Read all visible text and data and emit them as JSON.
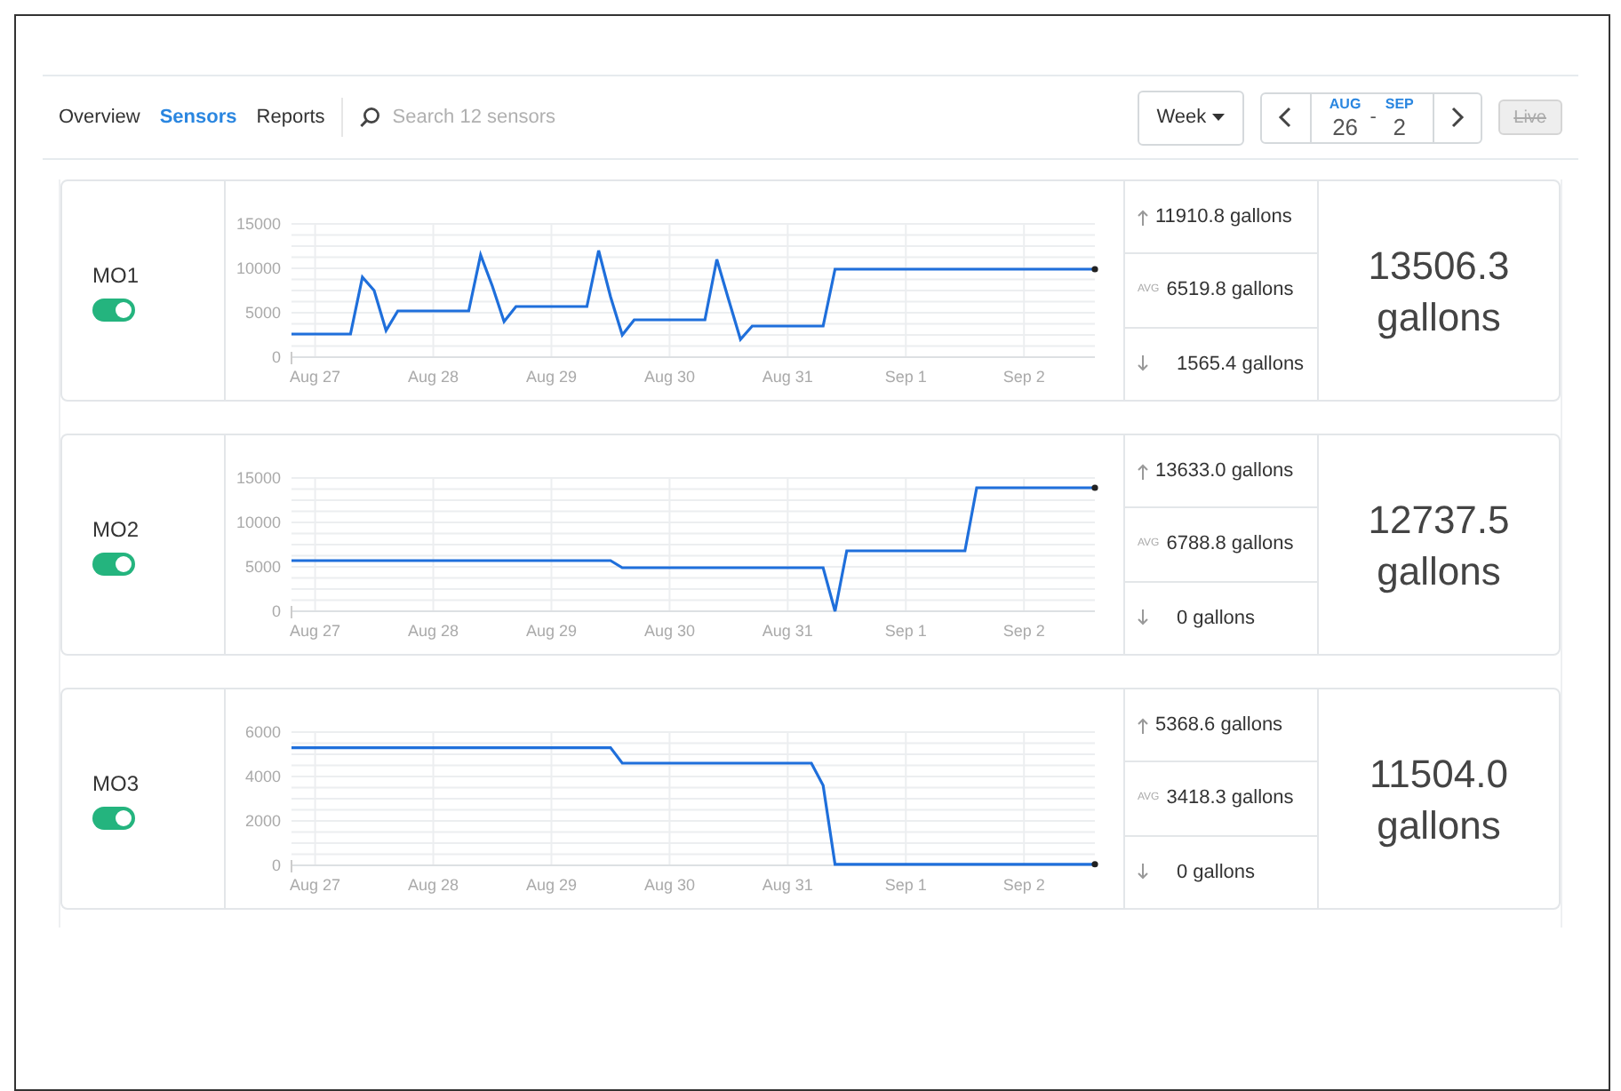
{
  "nav": {
    "tabs": [
      {
        "label": "Overview",
        "selected": false
      },
      {
        "label": "Sensors",
        "selected": true
      },
      {
        "label": "Reports",
        "selected": false
      }
    ],
    "search": {
      "placeholder": "Search 12 sensors"
    },
    "period": {
      "label": "Week"
    },
    "range": {
      "start_month": "AUG",
      "start_day": "26",
      "separator": "-",
      "end_month": "SEP",
      "end_day": "2"
    },
    "live": {
      "label": "Live",
      "disabled": true
    }
  },
  "sensors": [
    {
      "name": "MO1",
      "on": true,
      "max": "11910.8 gallons",
      "avg_label": "AVG",
      "avg": "6519.8 gallons",
      "min": "1565.4 gallons",
      "total": "13506.3",
      "unit": "gallons",
      "chart_data": {
        "type": "line",
        "grid": true,
        "ylim": [
          0,
          15000
        ],
        "yticks": [
          0,
          5000,
          10000,
          15000
        ],
        "categories": [
          null,
          null,
          "Aug 27",
          null,
          null,
          null,
          null,
          null,
          null,
          null,
          null,
          null,
          "Aug 28",
          null,
          null,
          null,
          null,
          null,
          null,
          null,
          null,
          null,
          "Aug 29",
          null,
          null,
          null,
          null,
          null,
          null,
          null,
          null,
          null,
          "Aug 30",
          null,
          null,
          null,
          null,
          null,
          null,
          null,
          null,
          null,
          "Aug 31",
          null,
          null,
          null,
          null,
          null,
          null,
          null,
          null,
          null,
          "Sep 1",
          null,
          null,
          null,
          null,
          null,
          null,
          null,
          null,
          null,
          "Sep 2",
          null,
          null,
          null,
          null,
          null,
          null
        ],
        "series": [
          {
            "color": "#1f6fdb",
            "values": [
              2600,
              2600,
              2600,
              2600,
              2600,
              2600,
              9000,
              7500,
              3000,
              5200,
              5200,
              5200,
              5200,
              5200,
              5200,
              5200,
              11500,
              8000,
              4000,
              5700,
              5700,
              5700,
              5700,
              5700,
              5700,
              5700,
              12000,
              6800,
              2500,
              4200,
              4200,
              4200,
              4200,
              4200,
              4200,
              4200,
              11000,
              6500,
              2000,
              3500,
              3500,
              3500,
              3500,
              3500,
              3500,
              3500,
              9900,
              9900,
              9900,
              9900,
              9900,
              9900,
              9900,
              9900,
              9900,
              9900,
              9900,
              9900,
              9900,
              9900,
              9900,
              9900,
              9900,
              9900,
              9900,
              9900,
              9900,
              9900,
              9900
            ]
          }
        ]
      }
    },
    {
      "name": "MO2",
      "on": true,
      "max": "13633.0 gallons",
      "avg_label": "AVG",
      "avg": "6788.8 gallons",
      "min": "0 gallons",
      "total": "12737.5",
      "unit": "gallons",
      "chart_data": {
        "type": "line",
        "grid": true,
        "ylim": [
          0,
          15000
        ],
        "yticks": [
          0,
          5000,
          10000,
          15000
        ],
        "categories": [
          null,
          null,
          "Aug 27",
          null,
          null,
          null,
          null,
          null,
          null,
          null,
          null,
          null,
          "Aug 28",
          null,
          null,
          null,
          null,
          null,
          null,
          null,
          null,
          null,
          "Aug 29",
          null,
          null,
          null,
          null,
          null,
          null,
          null,
          null,
          null,
          "Aug 30",
          null,
          null,
          null,
          null,
          null,
          null,
          null,
          null,
          null,
          "Aug 31",
          null,
          null,
          null,
          null,
          null,
          null,
          null,
          null,
          null,
          "Sep 1",
          null,
          null,
          null,
          null,
          null,
          null,
          null,
          null,
          null,
          "Sep 2",
          null,
          null,
          null,
          null,
          null,
          null
        ],
        "series": [
          {
            "color": "#1f6fdb",
            "values": [
              5700,
              5700,
              5700,
              5700,
              5700,
              5700,
              5700,
              5700,
              5700,
              5700,
              5700,
              5700,
              5700,
              5700,
              5700,
              5700,
              5700,
              5700,
              5700,
              5700,
              5700,
              5700,
              5700,
              5700,
              5700,
              5700,
              5700,
              5700,
              4900,
              4900,
              4900,
              4900,
              4900,
              4900,
              4900,
              4900,
              4900,
              4900,
              4900,
              4900,
              4900,
              4900,
              4900,
              4900,
              4900,
              4900,
              0,
              6800,
              6800,
              6800,
              6800,
              6800,
              6800,
              6800,
              6800,
              6800,
              6800,
              6800,
              13900,
              13900,
              13900,
              13900,
              13900,
              13900,
              13900,
              13900,
              13900,
              13900,
              13900
            ]
          }
        ]
      }
    },
    {
      "name": "MO3",
      "on": true,
      "max": "5368.6 gallons",
      "avg_label": "AVG",
      "avg": "3418.3 gallons",
      "min": "0 gallons",
      "total": "11504.0",
      "unit": "gallons",
      "chart_data": {
        "type": "line",
        "grid": true,
        "ylim": [
          0,
          6000
        ],
        "yticks": [
          0,
          2000,
          4000,
          6000
        ],
        "categories": [
          null,
          null,
          "Aug 27",
          null,
          null,
          null,
          null,
          null,
          null,
          null,
          null,
          null,
          "Aug 28",
          null,
          null,
          null,
          null,
          null,
          null,
          null,
          null,
          null,
          "Aug 29",
          null,
          null,
          null,
          null,
          null,
          null,
          null,
          null,
          null,
          "Aug 30",
          null,
          null,
          null,
          null,
          null,
          null,
          null,
          null,
          null,
          "Aug 31",
          null,
          null,
          null,
          null,
          null,
          null,
          null,
          null,
          null,
          "Sep 1",
          null,
          null,
          null,
          null,
          null,
          null,
          null,
          null,
          null,
          "Sep 2",
          null,
          null,
          null,
          null,
          null,
          null
        ],
        "series": [
          {
            "color": "#1f6fdb",
            "values": [
              5300,
              5300,
              5300,
              5300,
              5300,
              5300,
              5300,
              5300,
              5300,
              5300,
              5300,
              5300,
              5300,
              5300,
              5300,
              5300,
              5300,
              5300,
              5300,
              5300,
              5300,
              5300,
              5300,
              5300,
              5300,
              5300,
              5300,
              5300,
              4600,
              4600,
              4600,
              4600,
              4600,
              4600,
              4600,
              4600,
              4600,
              4600,
              4600,
              4600,
              4600,
              4600,
              4600,
              4600,
              4600,
              3600,
              50,
              50,
              50,
              50,
              50,
              50,
              50,
              50,
              50,
              50,
              50,
              50,
              50,
              50,
              50,
              50,
              50,
              50,
              50,
              50,
              50,
              50,
              50
            ]
          }
        ]
      }
    }
  ]
}
